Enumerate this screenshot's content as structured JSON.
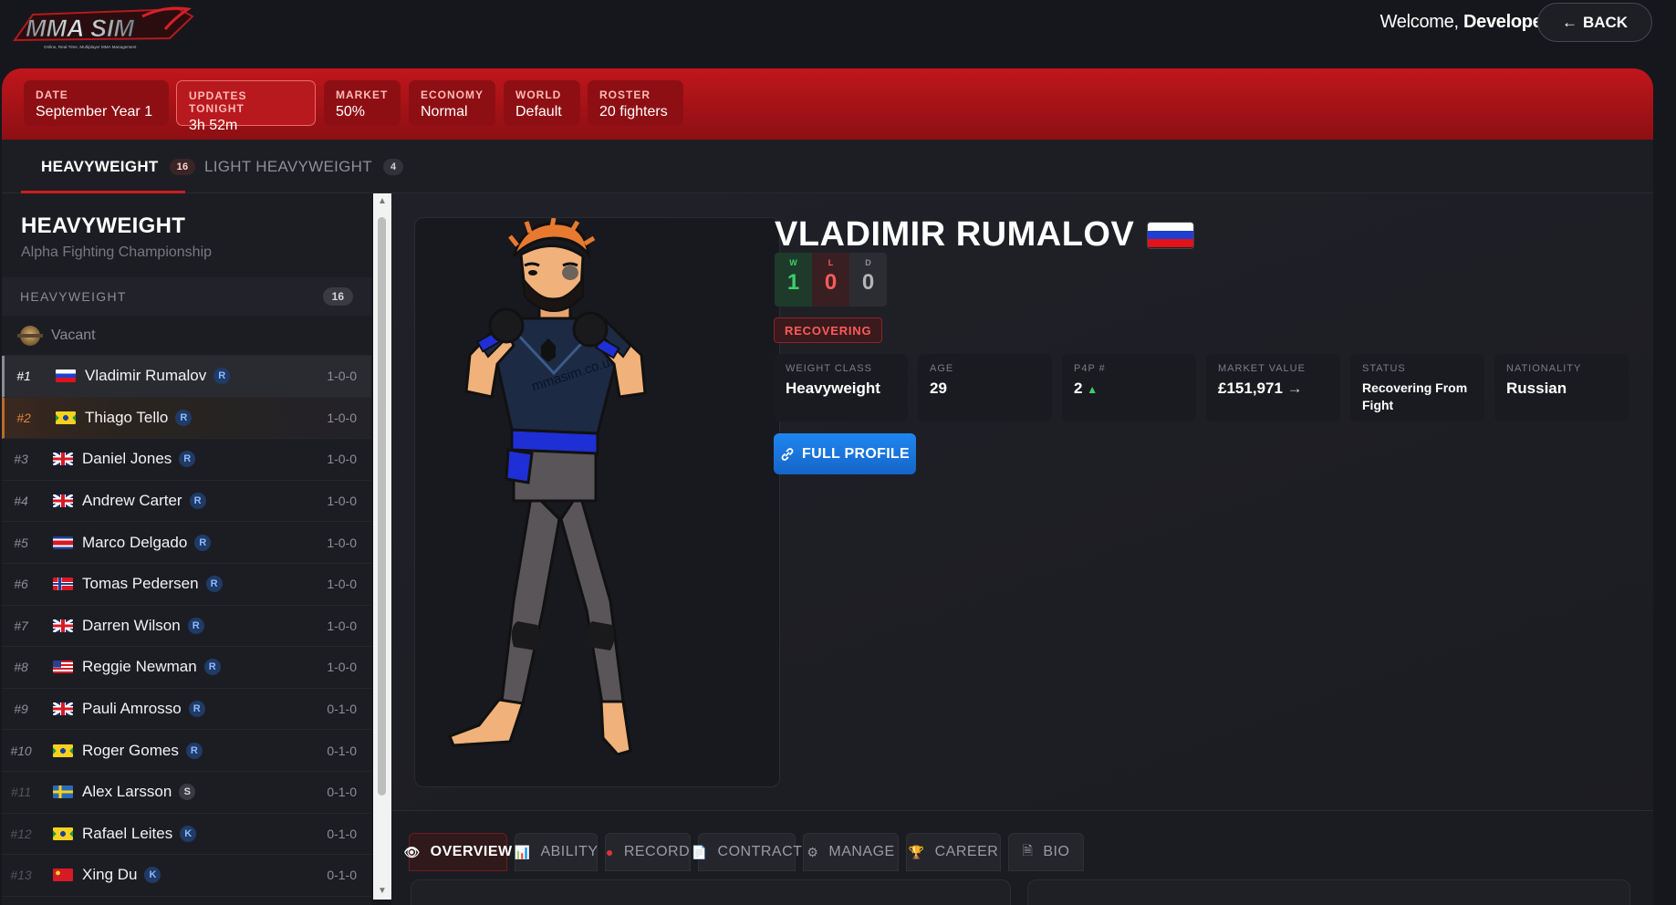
{
  "header": {
    "logo_text": "MMA SIM",
    "logo_tagline": "Online, Real-Time, Multiplayer MMA Management",
    "welcome_prefix": "Welcome,",
    "welcome_user": "Developer",
    "back_label": "BACK",
    "back_icon": "arrow-left-icon"
  },
  "status_chips": [
    {
      "label": "DATE",
      "value": "September Year 1"
    },
    {
      "label": "UPDATES TONIGHT",
      "value": "3h 52m"
    },
    {
      "label": "MARKET",
      "value": "50%"
    },
    {
      "label": "ECONOMY",
      "value": "Normal"
    },
    {
      "label": "WORLD",
      "value": "Default"
    },
    {
      "label": "ROSTER",
      "value": "20 fighters"
    }
  ],
  "weight_tabs": [
    {
      "label": "HEAVYWEIGHT",
      "count": "16",
      "active": true
    },
    {
      "label": "LIGHT HEAVYWEIGHT",
      "count": "4",
      "active": false
    }
  ],
  "roster": {
    "title": "HEAVYWEIGHT",
    "subtitle": "Alpha Fighting Championship",
    "division_label": "HEAVYWEIGHT",
    "division_count": "16",
    "vacant_label": "Vacant",
    "fighters": [
      {
        "rank": "#1",
        "name": "Vladimir Rumalov",
        "badge": "R",
        "record": "1-0-0",
        "flag": "ru"
      },
      {
        "rank": "#2",
        "name": "Thiago Tello",
        "badge": "R",
        "record": "1-0-0",
        "flag": "br"
      },
      {
        "rank": "#3",
        "name": "Daniel Jones",
        "badge": "R",
        "record": "1-0-0",
        "flag": "gb"
      },
      {
        "rank": "#4",
        "name": "Andrew Carter",
        "badge": "R",
        "record": "1-0-0",
        "flag": "gb"
      },
      {
        "rank": "#5",
        "name": "Marco Delgado",
        "badge": "R",
        "record": "1-0-0",
        "flag": "cr"
      },
      {
        "rank": "#6",
        "name": "Tomas Pedersen",
        "badge": "R",
        "record": "1-0-0",
        "flag": "no"
      },
      {
        "rank": "#7",
        "name": "Darren Wilson",
        "badge": "R",
        "record": "1-0-0",
        "flag": "gb"
      },
      {
        "rank": "#8",
        "name": "Reggie Newman",
        "badge": "R",
        "record": "1-0-0",
        "flag": "us"
      },
      {
        "rank": "#9",
        "name": "Pauli Amrosso",
        "badge": "R",
        "record": "0-1-0",
        "flag": "gb"
      },
      {
        "rank": "#10",
        "name": "Roger Gomes",
        "badge": "R",
        "record": "0-1-0",
        "flag": "br"
      },
      {
        "rank": "#11",
        "name": "Alex Larsson",
        "badge": "S",
        "record": "0-1-0",
        "flag": "se"
      },
      {
        "rank": "#12",
        "name": "Rafael Leites",
        "badge": "K",
        "record": "0-1-0",
        "flag": "br"
      },
      {
        "rank": "#13",
        "name": "Xing Du",
        "badge": "K",
        "record": "0-1-0",
        "flag": "cn"
      }
    ]
  },
  "fighter": {
    "name": "VLADIMIR RUMALOV",
    "shirt_text": "mmasim.co.uk",
    "wins_label": "W",
    "wins": "1",
    "losses_label": "L",
    "losses": "0",
    "draws_label": "D",
    "draws": "0",
    "status_pill": "RECOVERING",
    "stats": [
      {
        "label": "WEIGHT CLASS",
        "value": "Heavyweight"
      },
      {
        "label": "AGE",
        "value": "29"
      },
      {
        "label": "P4P #",
        "value": "2",
        "trend": "▲"
      },
      {
        "label": "MARKET VALUE",
        "value": "£151,971",
        "trend": "→"
      },
      {
        "label": "STATUS",
        "value": "Recovering From Fight"
      },
      {
        "label": "NATIONALITY",
        "value": "Russian"
      }
    ],
    "full_profile_label": "FULL PROFILE"
  },
  "profile_tabs": [
    {
      "label": "OVERVIEW",
      "icon": "eye-icon",
      "active": true
    },
    {
      "label": "ABILITY",
      "icon": "bar-chart-icon"
    },
    {
      "label": "RECORD",
      "icon": "boxing-glove-icon"
    },
    {
      "label": "CONTRACT",
      "icon": "document-icon"
    },
    {
      "label": "MANAGE",
      "icon": "gear-icon"
    },
    {
      "label": "CAREER",
      "icon": "trophy-icon"
    },
    {
      "label": "BIO",
      "icon": "page-icon"
    }
  ],
  "colors": {
    "accent_red": "#c0161c",
    "button_blue": "#1f86f0",
    "win_green": "#3fcf6c",
    "loss_red": "#ff5a5a"
  }
}
